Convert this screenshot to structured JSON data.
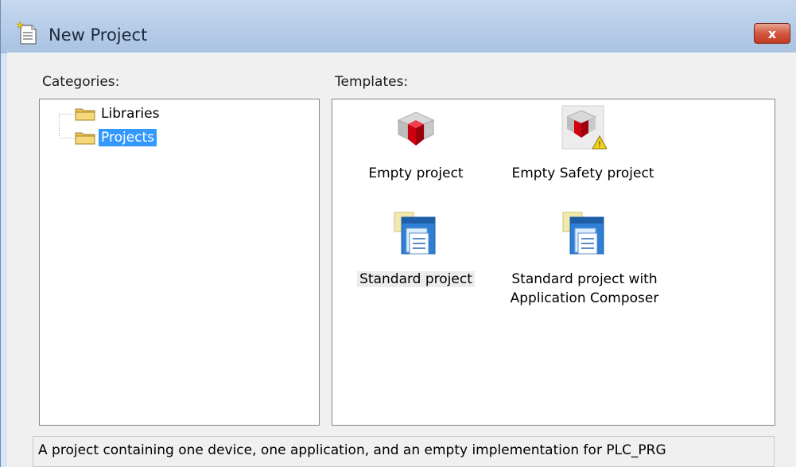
{
  "window": {
    "title": "New Project",
    "close_label": "x"
  },
  "categories": {
    "label": "Categories:",
    "items": [
      {
        "label": "Libraries",
        "selected": false
      },
      {
        "label": "Projects",
        "selected": true
      }
    ]
  },
  "templates": {
    "label": "Templates:",
    "items": [
      {
        "name": "Empty project",
        "icon": "red-cube-icon"
      },
      {
        "name": "Empty Safety project",
        "icon": "safety-cube-icon"
      },
      {
        "name": "Standard project",
        "icon": "standard-project-icon",
        "selected": true
      },
      {
        "name_line1": "Standard project with",
        "name_line2": "Application Composer",
        "icon": "standard-project-icon"
      }
    ]
  },
  "description": "A project containing one device, one application, and an empty implementation for PLC_PRG",
  "colors": {
    "selection": "#3399ff",
    "titlebar": "#b7cde8",
    "close": "#c23b22"
  }
}
